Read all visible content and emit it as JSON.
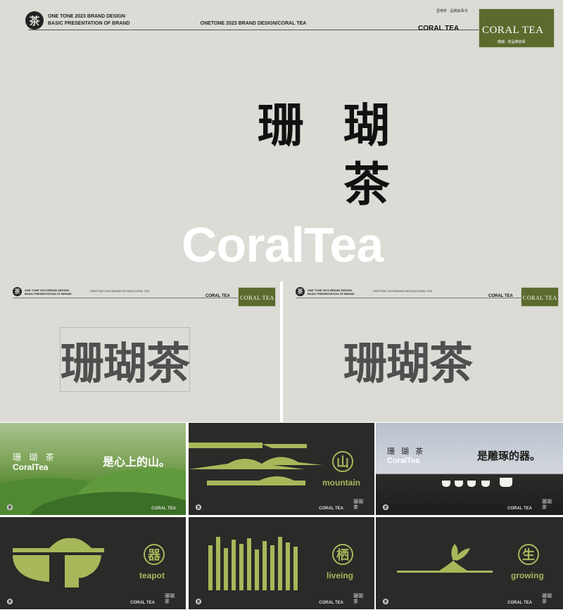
{
  "hero": {
    "logo_char": "茶",
    "brand_line1": "ONE TONE 2023 BRAND DESIGN",
    "brand_line2": "BASIC PRESENTATION OF BRAND",
    "center_title": "ONETONE 2023 BRAND DESIGN/CORAL TEA",
    "nav": "壹嗵茶 · 品牌故事书",
    "coral_label": "CORAL TEA",
    "card_title": "CORAL TEA",
    "card_sub": "珊瑚 · 茶品牌故事",
    "cn_char_1": "珊",
    "cn_char_2": "瑚",
    "cn_char_3": "茶",
    "en_name": "CoralTea"
  },
  "mid": {
    "logo_char": "茶",
    "brand_line1": "ONE TONE 2023 BRAND DESIGN",
    "brand_line2": "BASIC PRESENTATION OF BRAND",
    "center_title": "ONETONE 2023 BRAND DESIGN/CORAL TEA",
    "coral_label": "CORAL TEA",
    "card_title": "CORAL TEA",
    "wordmark": "珊瑚茶"
  },
  "grid": {
    "photo_cn": "珊 瑚 茶",
    "photo_en": "CoralTea",
    "slogan_mountain": "是心上的山。",
    "slogan_vessel": "是雕琢的器。",
    "footer_coral": "CORAL TEA",
    "footer_cn": "珊瑚茶",
    "footer_logo": "茶",
    "cells": [
      {
        "char": "山",
        "word": "mountain"
      },
      {
        "char": "器",
        "word": "teapot"
      },
      {
        "char": "栖",
        "word": "liveing"
      },
      {
        "char": "生",
        "word": "growing"
      }
    ]
  },
  "colors": {
    "accent_green": "#a6b85a",
    "card_green": "#5b6b2e",
    "dark_bg": "#2a2a28",
    "light_bg": "#dcdbd6"
  }
}
